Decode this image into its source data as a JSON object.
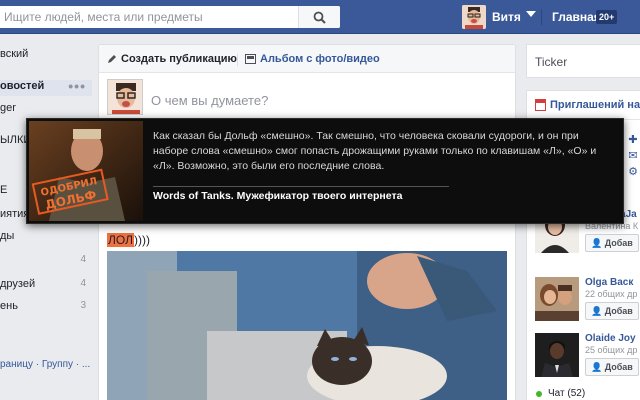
{
  "topbar": {
    "search_placeholder": "Ищите людей, места или предметы",
    "user_name": "Витя",
    "home_label": "Главная",
    "home_badge": "20+"
  },
  "leftnav": {
    "items": [
      {
        "label": "вский"
      },
      {
        "label": "овостей"
      },
      {
        "label": "ger"
      },
      {
        "label": "ЫЛКИ"
      },
      {
        "label": "Е"
      },
      {
        "label": "иятия"
      },
      {
        "label": "ды"
      },
      {
        "label": "",
        "count": "4"
      },
      {
        "label": "друзей",
        "count": "4"
      },
      {
        "label": "ень",
        "count": "3"
      }
    ],
    "footer": "раницу · Группу · ..."
  },
  "composer": {
    "tab_create": "Создать публикацию",
    "tab_album": "Альбом с фото/видео",
    "placeholder": "О чем вы думаете?"
  },
  "post": {
    "highlight": "ЛОЛ",
    "suffix": "))))"
  },
  "tooltip": {
    "stamp_line1": "ОДОБРИЛ",
    "stamp_line2": "ДОЛЬФ",
    "quote": "Как сказал бы Дольф «смешно». Так смешно, что человека сковали судороги, и он при наборе слова «смешно» смог попасть дрожащими руками только по клавишам «Л», «О» и «Л». Возможно, это были его последние слова.",
    "brand": "Words of Tanks. Мужефикатор твоего интернета"
  },
  "right": {
    "ticker": "Ticker",
    "invites": "Приглашений на м",
    "suggestions": [
      {
        "name": "Hajar HaJa",
        "mutual": "Валентина К друг.",
        "add": "Добав"
      },
      {
        "name": "Olga Васк",
        "mutual": "22 общих др",
        "add": "Добав"
      },
      {
        "name": "Olaide Joy",
        "mutual": "25 общих др",
        "add": "Добав"
      }
    ],
    "chat": "Чат (52)"
  }
}
